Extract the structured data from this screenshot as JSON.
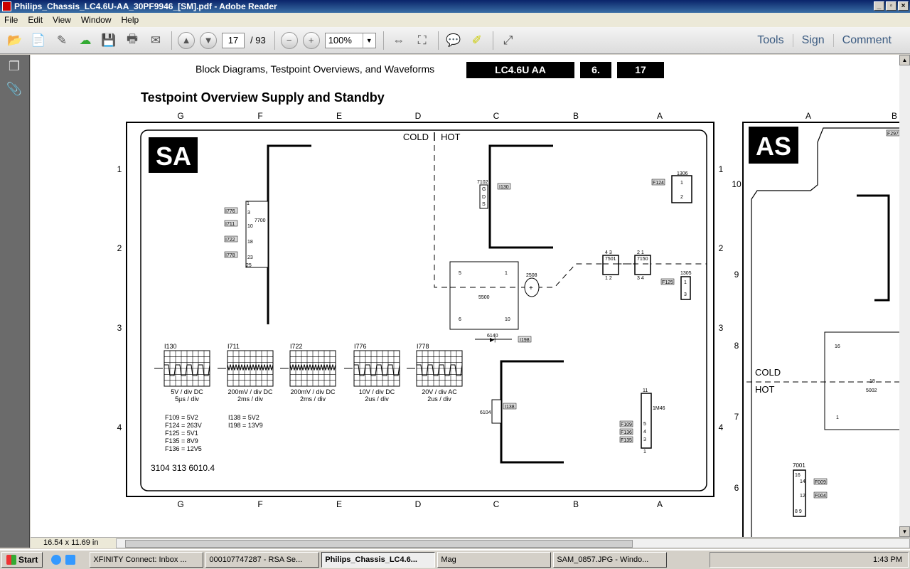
{
  "window": {
    "title": "Philips_Chassis_LC4.6U-AA_30PF9946_[SM].pdf - Adobe Reader",
    "min": "_",
    "max": "▫",
    "close": "×"
  },
  "menu": [
    "File",
    "Edit",
    "View",
    "Window",
    "Help"
  ],
  "toolbar": {
    "page": "17",
    "page_count": "/ 93",
    "zoom": "100%",
    "tools": "Tools",
    "sign": "Sign",
    "comment": "Comment"
  },
  "status": {
    "page_size": "16.54 x 11.69 in"
  },
  "doc": {
    "header": "Block Diagrams, Testpoint Overviews, and Waveforms",
    "model": "LC4.6U AA",
    "section": "6.",
    "page": "17",
    "title": "Testpoint Overview Supply and Standby",
    "col_letters": [
      "G",
      "F",
      "E",
      "D",
      "C",
      "B",
      "A"
    ],
    "row_numbers": [
      "1",
      "2",
      "3",
      "4"
    ],
    "sa": "SA",
    "as": "AS",
    "cold": "COLD",
    "hot": "HOT",
    "part_number": "3104 313 6010.4",
    "components": {
      "c7700": "7700",
      "c7102": "7102",
      "gds": [
        "G",
        "D",
        "S"
      ],
      "c1306": "1306",
      "c5500": "5500",
      "c2508": "2508",
      "c7501": "7501",
      "c7150": "7150",
      "c1305": "1305",
      "c6140": "6140",
      "c6104": "6104",
      "c1M46": "1M46",
      "pins5500": [
        "5",
        "1",
        "6",
        "10"
      ],
      "pins7700": [
        "1",
        "3",
        "10",
        "18",
        "23",
        "25"
      ],
      "pins1306": [
        "1",
        "2"
      ],
      "pins1305": [
        "1",
        "3"
      ],
      "pins7501": [
        "4 3",
        "1 2"
      ],
      "pins7150": [
        "2 1",
        "3 4"
      ],
      "pins1M46": [
        "11",
        "5",
        "4",
        "3",
        "1"
      ]
    },
    "tags": {
      "I776": "I776",
      "I711": "I711",
      "I722": "I722",
      "I778": "I778",
      "I130": "I130",
      "F124": "F124",
      "F125": "F125",
      "I198": "I198",
      "I138": "I138",
      "F109": "F109",
      "F136": "F136",
      "F135": "F135"
    },
    "waveforms": [
      {
        "name": "I130",
        "scale": "5V / div DC",
        "time": "5µs / div"
      },
      {
        "name": "I711",
        "scale": "200mV / div DC",
        "time": "2ms / div"
      },
      {
        "name": "I722",
        "scale": "200mV / div DC",
        "time": "2ms / div"
      },
      {
        "name": "I776",
        "scale": "10V / div DC",
        "time": "2us / div"
      },
      {
        "name": "I778",
        "scale": "20V / div AC",
        "time": "2us / div"
      }
    ],
    "voltages_left": [
      "F109 = 5V2",
      "F124 = 263V",
      "F125 = 5V1",
      "F135 = 8V9",
      "F136 = 12V5"
    ],
    "voltages_right": [
      "I138 = 5V2",
      "I198 = 13V9"
    ],
    "as_panel": {
      "col_letters": [
        "A",
        "B"
      ],
      "row_numbers": [
        "10",
        "9",
        "8",
        "7",
        "6"
      ],
      "tags": [
        "F297",
        "F009",
        "F004"
      ],
      "c5002": "5002",
      "c7001": "7001",
      "pins": [
        "16",
        "1",
        "16",
        "14",
        "12",
        "8 9",
        "18"
      ]
    }
  },
  "taskbar": {
    "start": "Start",
    "tasks": [
      "XFINITY Connect: Inbox ...",
      "000107747287 - RSA Se...",
      "Philips_Chassis_LC4.6...",
      "Mag",
      "SAM_0857.JPG - Windo..."
    ],
    "clock": "1:43 PM"
  }
}
